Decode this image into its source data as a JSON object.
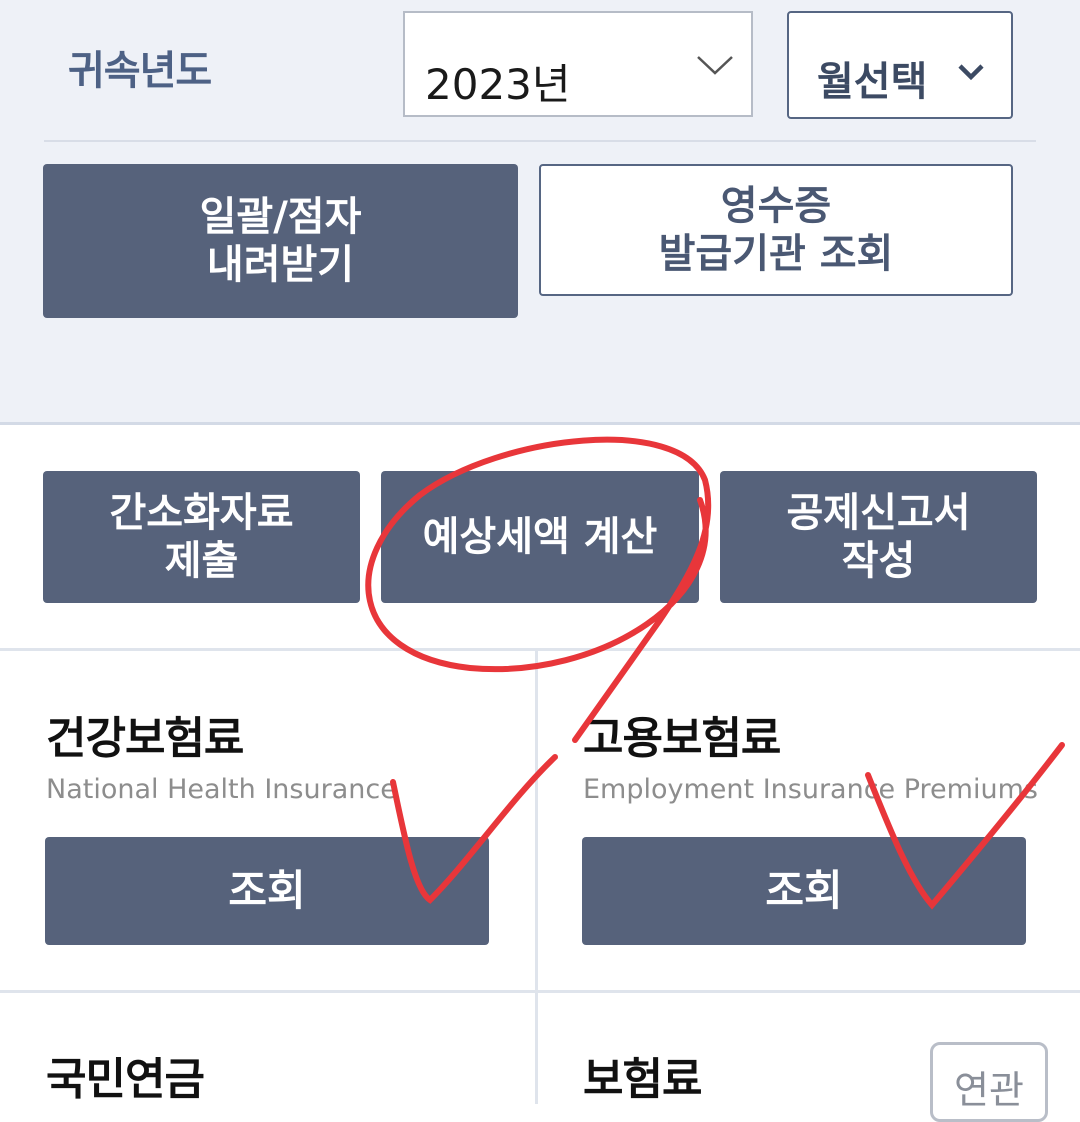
{
  "filters": {
    "year_label": "귀속년도",
    "year_value": "2023년",
    "month_value": "월선택"
  },
  "top_actions": {
    "bulk_download": "일괄/점자\n내려받기",
    "receipt_lookup": "영수증\n발급기관 조회"
  },
  "main_actions": {
    "submit_data": "간소화자료\n제출",
    "estimate_tax": "예상세액 계산",
    "write_report": "공제신고서\n작성"
  },
  "cards": [
    {
      "title": "건강보험료",
      "subtitle": "National Health Insurance",
      "button": "조회"
    },
    {
      "title": "고용보험료",
      "subtitle": "Employment Insurance Premiums",
      "button": "조회"
    },
    {
      "title": "국민연금"
    },
    {
      "title": "보험료",
      "tag": "연관"
    }
  ],
  "colors": {
    "button_dark": "#56627b",
    "panel_bg": "#eef1f7",
    "label_blue": "#4d6185",
    "annotation_red": "#e8363a"
  },
  "icons": {
    "year_dropdown": "chevron-down-icon",
    "month_dropdown": "chevron-down-icon"
  }
}
